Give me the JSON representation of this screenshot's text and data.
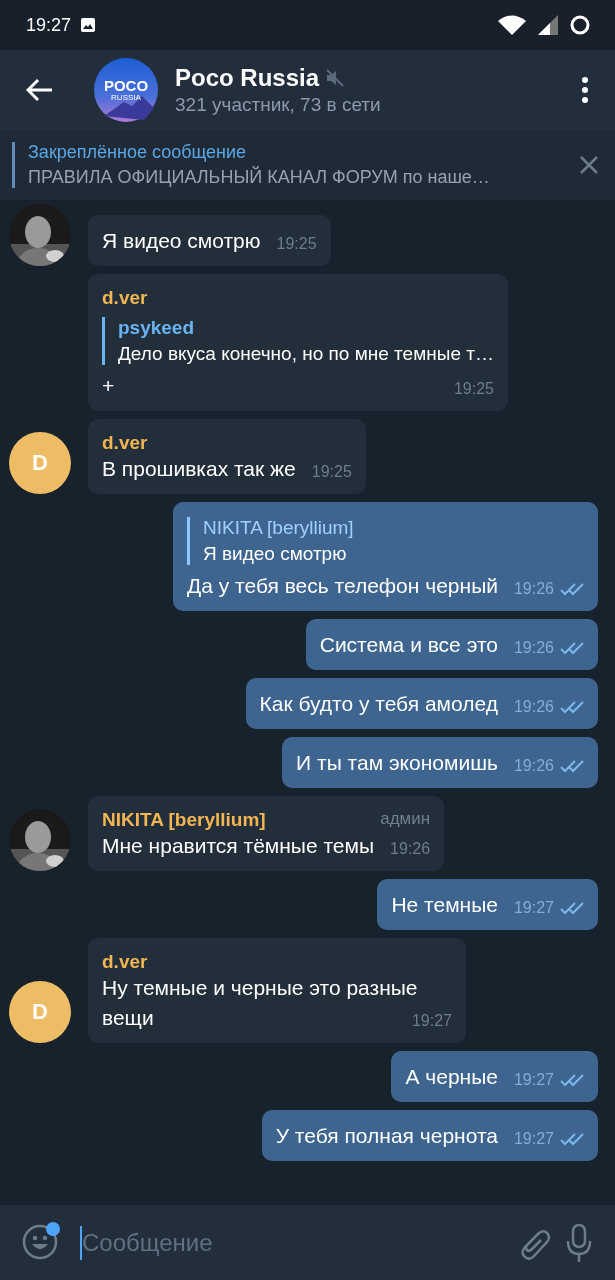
{
  "status_bar": {
    "time": "19:27"
  },
  "header": {
    "avatar_title": "POCO",
    "avatar_subtitle": "RUSSIA",
    "title": "Poco Russia",
    "muted": true,
    "subtitle": "321 участник, 73 в сети"
  },
  "pinned": {
    "title": "Закреплённое сообщение",
    "text": "ПРАВИЛА ОФИЦИАЛЬНЫЙ КАНАЛ ФОРУМ по наше…"
  },
  "messages": [
    {
      "kind": "in",
      "text": "Я видео смотрю",
      "time": "19:25"
    },
    {
      "kind": "in",
      "sender": "d.ver",
      "reply": {
        "author": "psykeed",
        "text": "Дело вкуса конечно, но по мне темные т…"
      },
      "text": "+",
      "time": "19:25"
    },
    {
      "kind": "in",
      "avatar": {
        "kind": "letter",
        "letter": "D"
      },
      "sender": "d.ver",
      "text": "В прошивках так же",
      "time": "19:25"
    },
    {
      "kind": "out",
      "reply": {
        "author": "NIKITA [beryllium]",
        "text": "Я видео смотрю"
      },
      "text": "Да у тебя весь телефон черный",
      "time": "19:26",
      "read": true
    },
    {
      "kind": "out",
      "text": "Система и все это",
      "time": "19:26",
      "read": true
    },
    {
      "kind": "out",
      "text": "Как будто у тебя амолед",
      "time": "19:26",
      "read": true
    },
    {
      "kind": "out",
      "text": "И ты там экономишь",
      "time": "19:26",
      "read": true
    },
    {
      "kind": "in",
      "sender": "NIKITA [beryllium]",
      "role": "админ",
      "text": "Мне нравится тёмные темы",
      "time": "19:26"
    },
    {
      "kind": "out",
      "text": "Не темные",
      "time": "19:27",
      "read": true
    },
    {
      "kind": "in",
      "avatar": {
        "kind": "letter",
        "letter": "D"
      },
      "sender": "d.ver",
      "text": "Ну темные и черные это разные вещи",
      "time": "19:27"
    },
    {
      "kind": "out",
      "text": "А черные",
      "time": "19:27",
      "read": true
    },
    {
      "kind": "out",
      "text": "У тебя полная чернота",
      "time": "19:27",
      "read": true
    }
  ],
  "input": {
    "placeholder": "Сообщение"
  }
}
